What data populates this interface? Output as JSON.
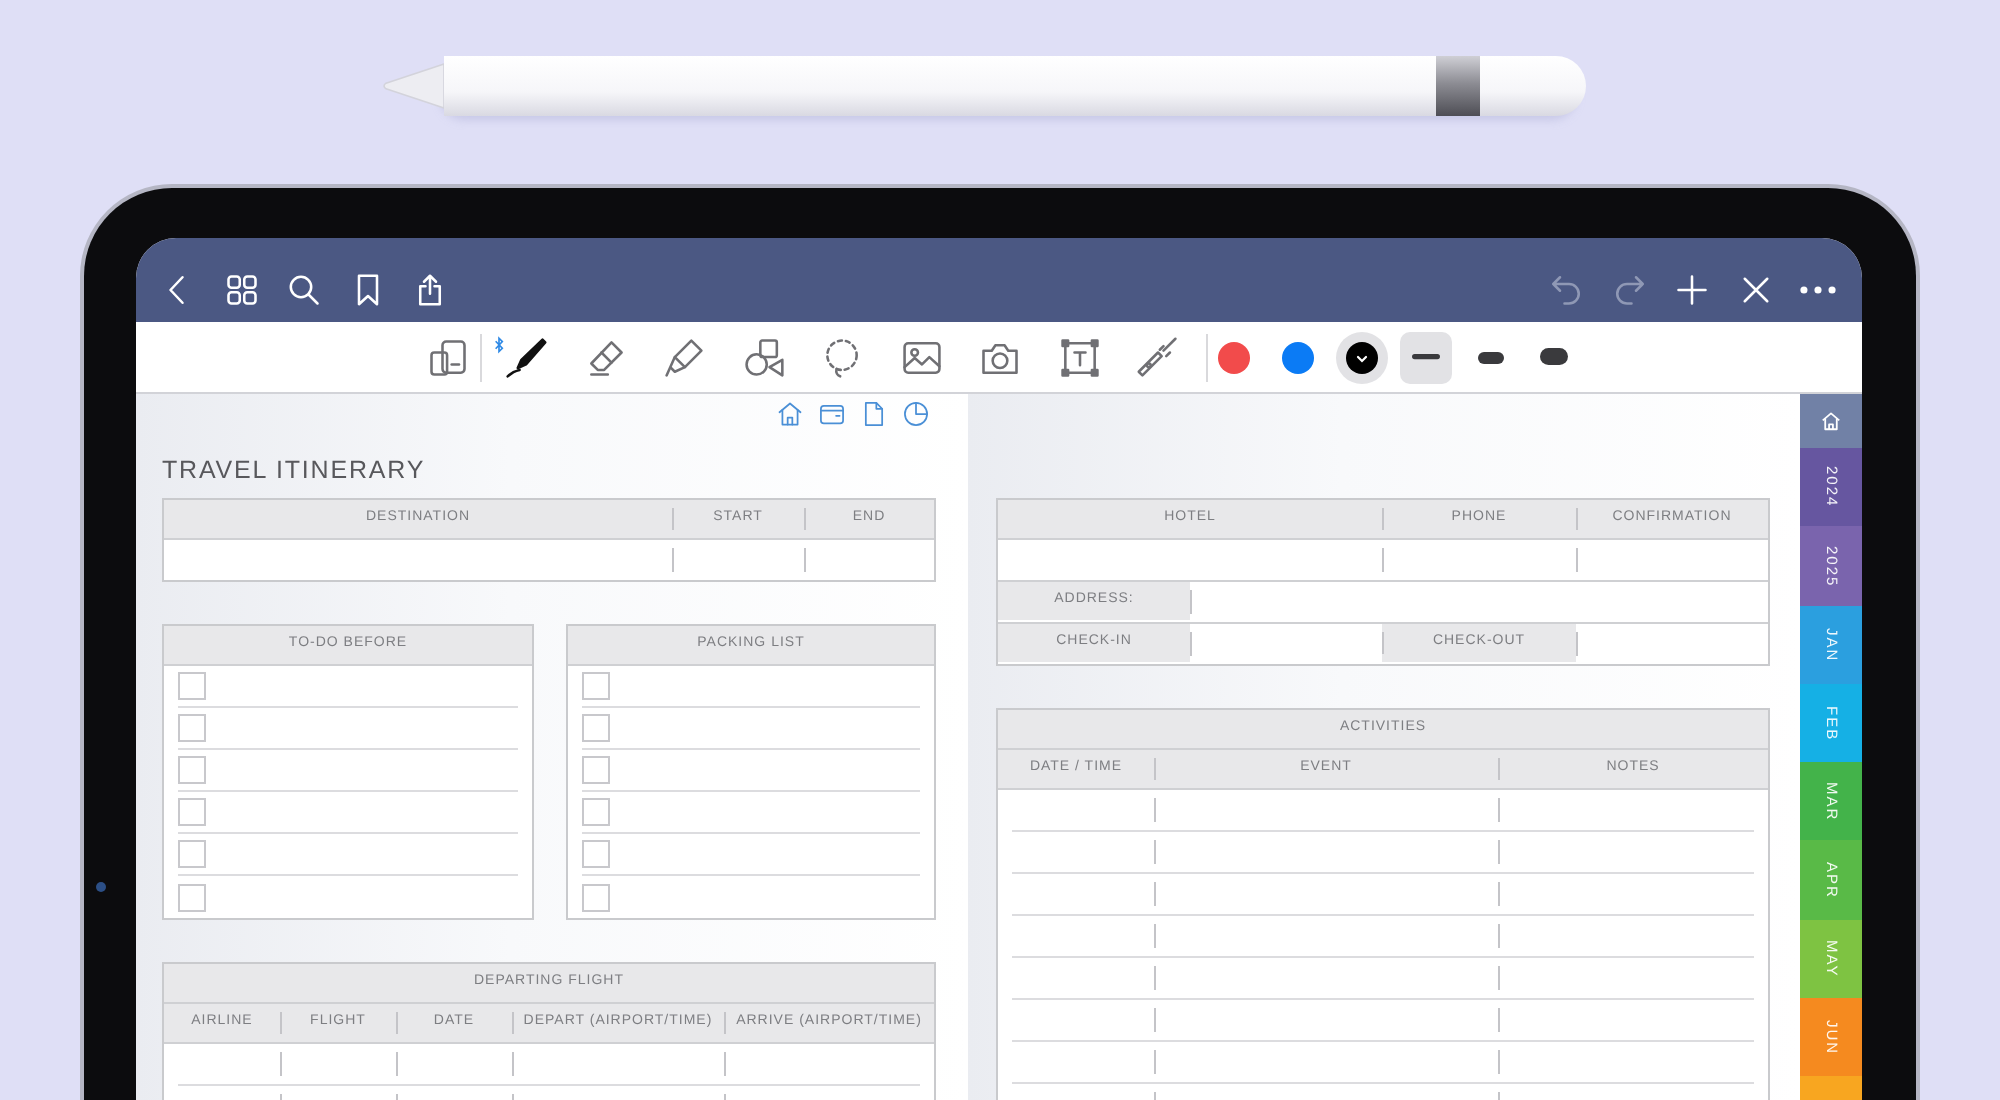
{
  "top_bar": {
    "left": [
      {
        "kind": "back"
      },
      {
        "kind": "grid"
      },
      {
        "kind": "search"
      },
      {
        "kind": "bookmark"
      },
      {
        "kind": "share"
      }
    ],
    "right": [
      {
        "kind": "undo",
        "disabled": true
      },
      {
        "kind": "redo",
        "disabled": true
      },
      {
        "kind": "add",
        "disabled": false
      },
      {
        "kind": "close",
        "disabled": false
      },
      {
        "kind": "more",
        "disabled": false
      }
    ]
  },
  "toolbar": {
    "tools": [
      {
        "kind": "readonly",
        "selected": false
      },
      {
        "kind": "pen",
        "selected": true
      },
      {
        "kind": "eraser",
        "selected": false
      },
      {
        "kind": "highlighter",
        "selected": false
      },
      {
        "kind": "shapes",
        "selected": false
      },
      {
        "kind": "lasso",
        "selected": false
      },
      {
        "kind": "image",
        "selected": false
      },
      {
        "kind": "camera",
        "selected": false
      },
      {
        "kind": "textbox",
        "selected": false
      },
      {
        "kind": "laser",
        "selected": false
      }
    ],
    "colors": [
      {
        "color": "#f24b4b",
        "selected": false
      },
      {
        "color": "#0b7bf5",
        "selected": false
      },
      {
        "color": "#000000",
        "selected": true
      }
    ],
    "widths": [
      {
        "kind": "thin",
        "selected": true
      },
      {
        "kind": "medium",
        "selected": false
      },
      {
        "kind": "thick",
        "selected": false
      }
    ]
  },
  "left_page": {
    "links": [
      {
        "kind": "home"
      },
      {
        "kind": "notebook"
      },
      {
        "kind": "page"
      },
      {
        "kind": "chart"
      }
    ],
    "title": "TRAVEL ITINERARY",
    "trip": {
      "columns": [
        "DESTINATION",
        "START",
        "END"
      ]
    },
    "todo": {
      "title": "TO-DO BEFORE",
      "items": [
        {
          "checked": false
        },
        {
          "checked": false
        },
        {
          "checked": false
        },
        {
          "checked": false
        },
        {
          "checked": false
        },
        {
          "checked": false
        }
      ]
    },
    "packing": {
      "title": "PACKING LIST",
      "items": [
        {
          "checked": false
        },
        {
          "checked": false
        },
        {
          "checked": false
        },
        {
          "checked": false
        },
        {
          "checked": false
        },
        {
          "checked": false
        }
      ]
    },
    "departing_flight": {
      "title": "DEPARTING FLIGHT",
      "columns": [
        "AIRLINE",
        "FLIGHT",
        "DATE",
        "DEPART (AIRPORT/TIME)",
        "ARRIVE (AIRPORT/TIME)"
      ]
    }
  },
  "right_page": {
    "hotel": {
      "columns": [
        "HOTEL",
        "PHONE",
        "CONFIRMATION"
      ],
      "address_label": "ADDRESS:",
      "check_in_label": "CHECK-IN",
      "check_out_label": "CHECK-OUT"
    },
    "activities": {
      "title": "ACTIVITIES",
      "columns": [
        "DATE / TIME",
        "EVENT",
        "NOTES"
      ]
    }
  },
  "side_tabs": [
    {
      "kind": "home",
      "color": "#7181a6"
    },
    {
      "kind": "year",
      "label": "2024",
      "color": "#6656a0"
    },
    {
      "kind": "year",
      "label": "2025",
      "color": "#7a64ad"
    },
    {
      "kind": "month",
      "label": "JAN",
      "color": "#2b9fdf"
    },
    {
      "kind": "month",
      "label": "FEB",
      "color": "#15b0e5"
    },
    {
      "kind": "month",
      "label": "MAR",
      "color": "#43b34a"
    },
    {
      "kind": "month",
      "label": "APR",
      "color": "#59ba47"
    },
    {
      "kind": "month",
      "label": "MAY",
      "color": "#7ec342"
    },
    {
      "kind": "month",
      "label": "JUN",
      "color": "#f58a1f"
    },
    {
      "kind": "month",
      "color": "#f8a620"
    }
  ]
}
